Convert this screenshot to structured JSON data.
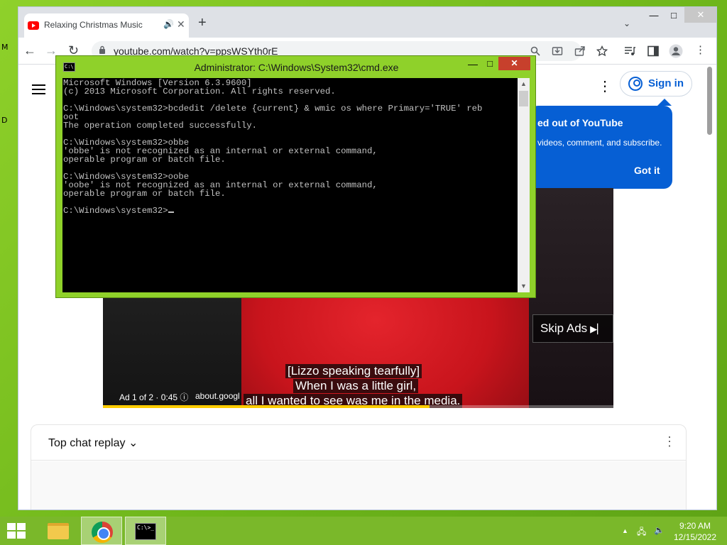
{
  "desktop": {
    "glyph_top": "M",
    "glyph_mid": "D"
  },
  "chrome": {
    "tab_title": "Relaxing Christmas Music ☃",
    "tab_audio_icon": "🔊",
    "tab_close": "✕",
    "new_tab": "+",
    "tab_search": "⌄",
    "win_min": "—",
    "win_max": "□",
    "win_close": "✕",
    "nav_back": "←",
    "nav_forward": "→",
    "nav_reload": "↻",
    "url": "youtube.com/watch?v=ppsWSYth0rE",
    "icons": [
      "search-icon",
      "install-icon",
      "share-icon",
      "bookmark-star-icon",
      "media-control-icon",
      "side-panel-icon",
      "profile-icon",
      "menu-icon"
    ]
  },
  "youtube": {
    "kebab": "⋮",
    "sign_in": "Sign in",
    "popup": {
      "title": "ed out of YouTube",
      "body": "videos, comment, and subscribe.",
      "button": "Got it"
    },
    "video": {
      "skip_ads": "Skip Ads",
      "skip_icon": "▶▏",
      "captions": [
        "[Lizzo speaking tearfully]",
        "When I was a little girl,",
        "all I wanted to see was me in the media."
      ],
      "ad_info": "Ad 1 of 2 · 0:45 ⓘ",
      "ad_link": "about.googl",
      "progress": 0.64
    },
    "chat": {
      "title": "Top chat replay ⌄",
      "kebab": "⋮"
    }
  },
  "cmd": {
    "title": "Administrator: C:\\Windows\\System32\\cmd.exe",
    "icon_text": "C:\\",
    "min": "—",
    "max": "□",
    "close": "✕",
    "lines": "Microsoft Windows [Version 6.3.9600]\n(c) 2013 Microsoft Corporation. All rights reserved.\n\nC:\\Windows\\system32>bcdedit /delete {current} & wmic os where Primary='TRUE' reb\noot\nThe operation completed successfully.\n\nC:\\Windows\\system32>obbe\n'obbe' is not recognized as an internal or external command,\noperable program or batch file.\n\nC:\\Windows\\system32>oobe\n'oobe' is not recognized as an internal or external command,\noperable program or batch file.\n\nC:\\Windows\\system32>",
    "scroll_up": "▲",
    "scroll_down": "▼"
  },
  "taskbar": {
    "cmd_label": "C:\\>_",
    "tray_chevron": "▲",
    "tray_network": "🖧",
    "tray_volume": "🔈",
    "time": "9:20 AM",
    "date": "12/15/2022"
  }
}
